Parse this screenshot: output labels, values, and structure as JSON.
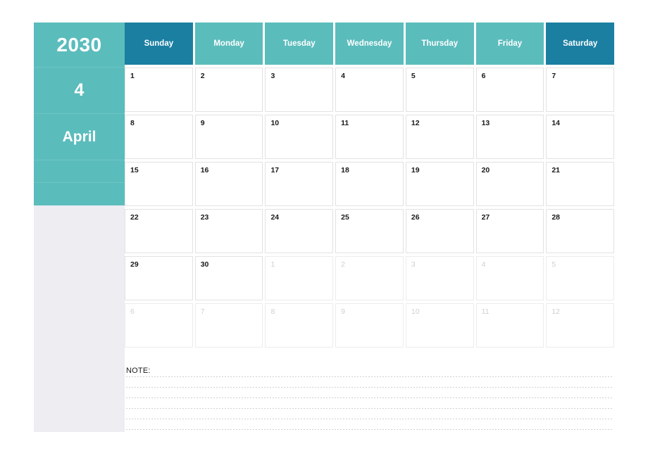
{
  "sidebar": {
    "year": "2030",
    "month_number": "4",
    "month_name": "April",
    "blank_rows": [
      "",
      ""
    ],
    "background_color": "#ededf2",
    "accent_color": "#5bbcbc"
  },
  "header": {
    "weekday_labels": [
      "Sunday",
      "Monday",
      "Tuesday",
      "Wednesday",
      "Thursday",
      "Friday",
      "Saturday"
    ],
    "weekend_indices": [
      0,
      6
    ],
    "weekday_color": "#5bbcbc",
    "weekend_color": "#1b7fa2",
    "text_color": "#ffffff"
  },
  "grid": {
    "weeks": [
      [
        {
          "day": "1",
          "current_month": true
        },
        {
          "day": "2",
          "current_month": true
        },
        {
          "day": "3",
          "current_month": true
        },
        {
          "day": "4",
          "current_month": true
        },
        {
          "day": "5",
          "current_month": true
        },
        {
          "day": "6",
          "current_month": true
        },
        {
          "day": "7",
          "current_month": true
        }
      ],
      [
        {
          "day": "8",
          "current_month": true
        },
        {
          "day": "9",
          "current_month": true
        },
        {
          "day": "10",
          "current_month": true
        },
        {
          "day": "11",
          "current_month": true
        },
        {
          "day": "12",
          "current_month": true
        },
        {
          "day": "13",
          "current_month": true
        },
        {
          "day": "14",
          "current_month": true
        }
      ],
      [
        {
          "day": "15",
          "current_month": true
        },
        {
          "day": "16",
          "current_month": true
        },
        {
          "day": "17",
          "current_month": true
        },
        {
          "day": "18",
          "current_month": true
        },
        {
          "day": "19",
          "current_month": true
        },
        {
          "day": "20",
          "current_month": true
        },
        {
          "day": "21",
          "current_month": true
        }
      ],
      [
        {
          "day": "22",
          "current_month": true
        },
        {
          "day": "23",
          "current_month": true
        },
        {
          "day": "24",
          "current_month": true
        },
        {
          "day": "25",
          "current_month": true
        },
        {
          "day": "26",
          "current_month": true
        },
        {
          "day": "27",
          "current_month": true
        },
        {
          "day": "28",
          "current_month": true
        }
      ],
      [
        {
          "day": "29",
          "current_month": true
        },
        {
          "day": "30",
          "current_month": true
        },
        {
          "day": "1",
          "current_month": false
        },
        {
          "day": "2",
          "current_month": false
        },
        {
          "day": "3",
          "current_month": false
        },
        {
          "day": "4",
          "current_month": false
        },
        {
          "day": "5",
          "current_month": false
        }
      ],
      [
        {
          "day": "6",
          "current_month": false
        },
        {
          "day": "7",
          "current_month": false
        },
        {
          "day": "8",
          "current_month": false
        },
        {
          "day": "9",
          "current_month": false
        },
        {
          "day": "10",
          "current_month": false
        },
        {
          "day": "11",
          "current_month": false
        },
        {
          "day": "12",
          "current_month": false
        }
      ]
    ]
  },
  "note": {
    "label": "NOTE:",
    "line_count": 6
  }
}
